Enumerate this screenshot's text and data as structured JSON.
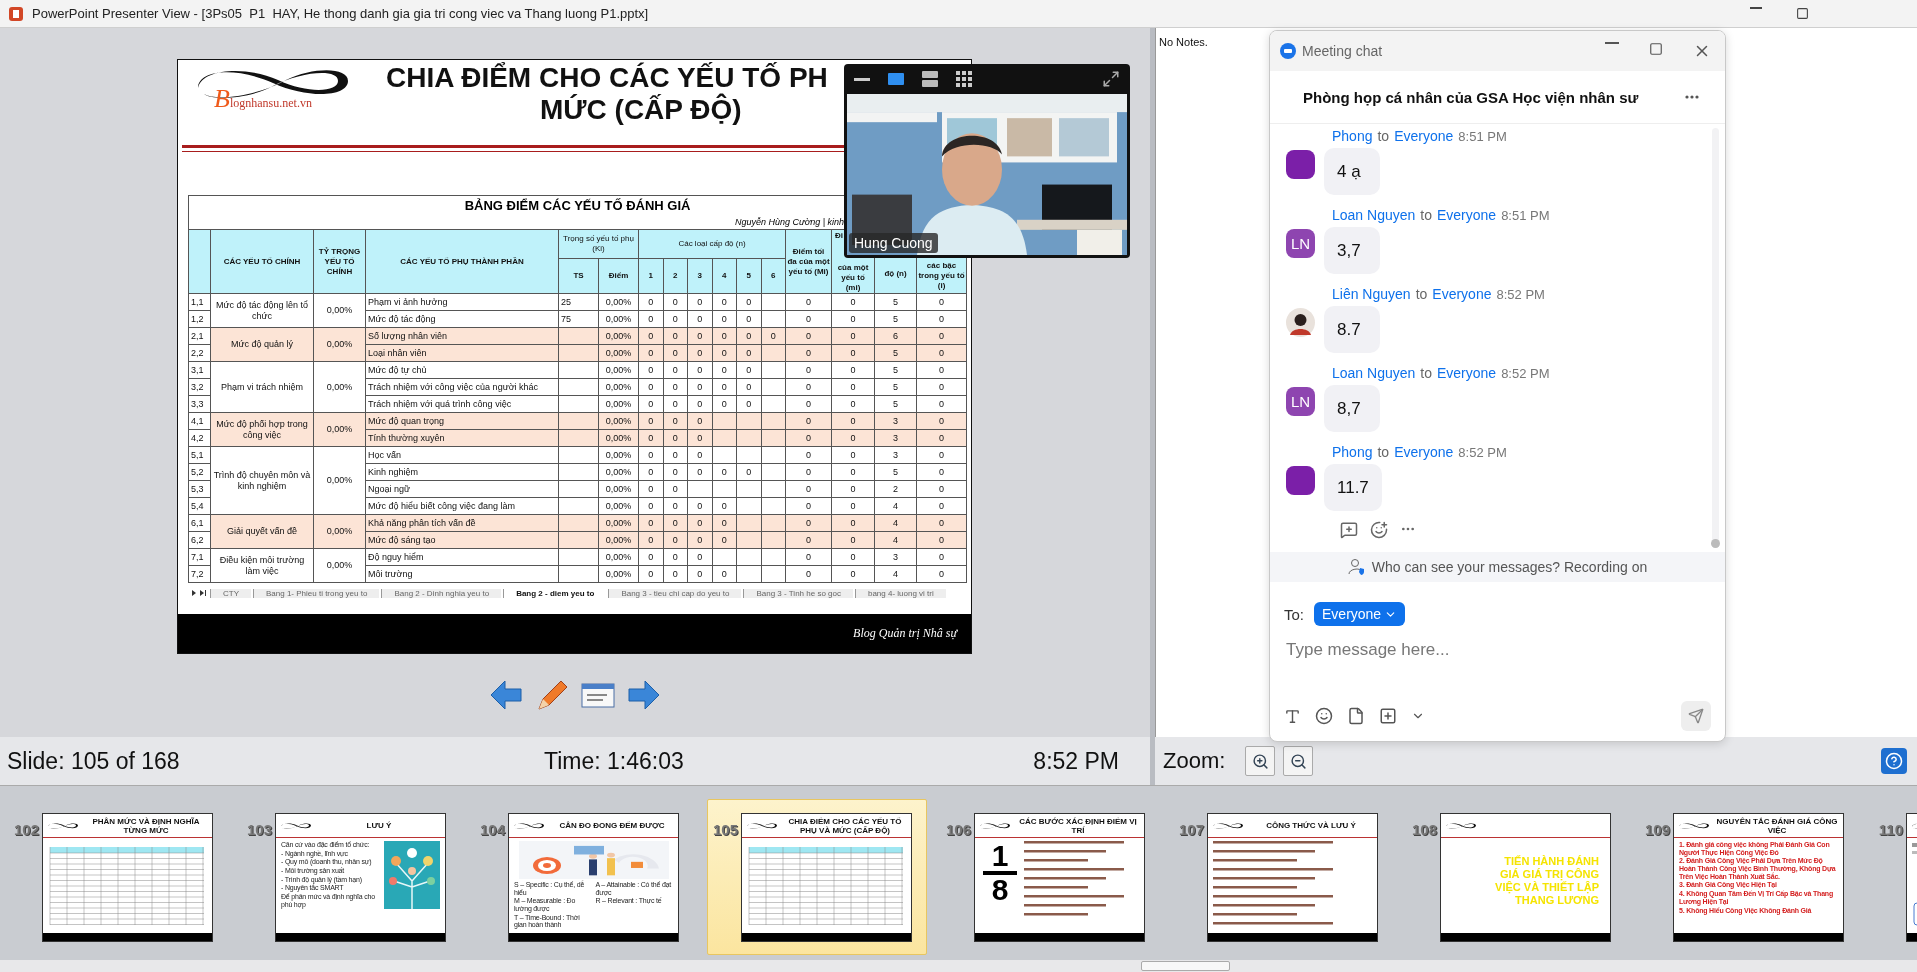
{
  "window": {
    "title": "PowerPoint Presenter View - [3Ps05  P1  HAY, He thong danh gia gia tri cong viec va Thang luong P1.pptx]"
  },
  "slide": {
    "logo": "Blognhansu.net.vn",
    "title_lines": [
      "CHIA ĐIỂM CHO CÁC YẾU TỐ PH",
      "MỨC (CẤP ĐỘ)"
    ],
    "table": {
      "title": "BẢNG ĐIỂM CÁC YẾU TỐ ĐÁNH GIÁ",
      "author": "Nguyễn Hùng Cường | kinh",
      "headers": {
        "main": "CÁC YẾU TỐ CHÍNH",
        "ratio": "TỶ TRỌNG YẾU TỐ CHÍNH",
        "sub": "CÁC YẾU TỐ PHỤ THÀNH PHẦN",
        "weight": "Trọng số yếu tố phụ (Ki)",
        "ts": "TS",
        "score": "Điểm",
        "levels": "Các loại cấp độ (n)",
        "level_numbers": [
          "1",
          "2",
          "3",
          "4",
          "5",
          "6"
        ],
        "max": "Điểm tối đa của một yếu tố (Mi)",
        "min_top": "Đi",
        "min": "của một yếu tố (mi)",
        "count": "độ (n)",
        "step": "các bậc trong yếu tố (i)"
      },
      "groups": [
        {
          "name": "Mức độ tác động lên tổ chức",
          "ratio": "0,00%",
          "shaded": false,
          "rows": [
            {
              "code": "1,1",
              "name": "Phạm vi ảnh hưởng",
              "ts": "25",
              "score": "0,00%",
              "levels": [
                "0",
                "0",
                "0",
                "0",
                "0"
              ],
              "max": "0",
              "min": "0",
              "count": "5",
              "step": "0"
            },
            {
              "code": "1,2",
              "name": "Mức độ tác động",
              "ts": "75",
              "score": "0,00%",
              "levels": [
                "0",
                "0",
                "0",
                "0",
                "0"
              ],
              "max": "0",
              "min": "0",
              "count": "5",
              "step": "0"
            }
          ]
        },
        {
          "name": "Mức độ quản lý",
          "ratio": "0,00%",
          "shaded": true,
          "rows": [
            {
              "code": "2,1",
              "name": "Số lượng nhân viên",
              "score": "0,00%",
              "levels": [
                "0",
                "0",
                "0",
                "0",
                "0",
                "0"
              ],
              "max": "0",
              "min": "0",
              "count": "6",
              "step": "0"
            },
            {
              "code": "2,2",
              "name": "Loại nhân viên",
              "score": "0,00%",
              "levels": [
                "0",
                "0",
                "0",
                "0",
                "0"
              ],
              "max": "0",
              "min": "0",
              "count": "5",
              "step": "0"
            }
          ]
        },
        {
          "name": "Phạm vi trách nhiệm",
          "ratio": "0,00%",
          "shaded": false,
          "rows": [
            {
              "code": "3,1",
              "name": "Mức độ tự chủ",
              "score": "0,00%",
              "levels": [
                "0",
                "0",
                "0",
                "0",
                "0"
              ],
              "max": "0",
              "min": "0",
              "count": "5",
              "step": "0"
            },
            {
              "code": "3,2",
              "name": "Trách nhiệm với công việc của người khác",
              "score": "0,00%",
              "levels": [
                "0",
                "0",
                "0",
                "0",
                "0"
              ],
              "max": "0",
              "min": "0",
              "count": "5",
              "step": "0"
            },
            {
              "code": "3,3",
              "name": "Trách nhiệm với quá trình công việc",
              "score": "0,00%",
              "levels": [
                "0",
                "0",
                "0",
                "0",
                "0"
              ],
              "max": "0",
              "min": "0",
              "count": "5",
              "step": "0"
            }
          ]
        },
        {
          "name": "Mức độ phối hợp trong công việc",
          "ratio": "0,00%",
          "shaded": true,
          "rows": [
            {
              "code": "4,1",
              "name": "Mức độ quan trọng",
              "score": "0,00%",
              "levels": [
                "0",
                "0",
                "0"
              ],
              "max": "0",
              "min": "0",
              "count": "3",
              "step": "0"
            },
            {
              "code": "4,2",
              "name": "Tính thường xuyên",
              "score": "0,00%",
              "levels": [
                "0",
                "0",
                "0"
              ],
              "max": "0",
              "min": "0",
              "count": "3",
              "step": "0"
            }
          ]
        },
        {
          "name": "Trình độ chuyên môn và kinh nghiệm",
          "ratio": "0,00%",
          "shaded": false,
          "rows": [
            {
              "code": "5,1",
              "name": "Học vấn",
              "score": "0,00%",
              "levels": [
                "0",
                "0",
                "0"
              ],
              "max": "0",
              "min": "0",
              "count": "3",
              "step": "0"
            },
            {
              "code": "5,2",
              "name": "Kinh nghiệm",
              "score": "0,00%",
              "levels": [
                "0",
                "0",
                "0",
                "0",
                "0"
              ],
              "max": "0",
              "min": "0",
              "count": "5",
              "step": "0"
            },
            {
              "code": "5,3",
              "name": "Ngoại ngữ",
              "score": "0,00%",
              "levels": [
                "0",
                "0"
              ],
              "max": "0",
              "min": "0",
              "count": "2",
              "step": "0"
            },
            {
              "code": "5,4",
              "name": "Mức độ hiểu biết công việc đang làm",
              "score": "0,00%",
              "levels": [
                "0",
                "0",
                "0",
                "0"
              ],
              "max": "0",
              "min": "0",
              "count": "4",
              "step": "0"
            }
          ]
        },
        {
          "name": "Giải quyết vấn đề",
          "ratio": "0,00%",
          "shaded": true,
          "rows": [
            {
              "code": "6,1",
              "name": "Khả năng phân tích vấn đề",
              "score": "0,00%",
              "levels": [
                "0",
                "0",
                "0",
                "0"
              ],
              "max": "0",
              "min": "0",
              "count": "4",
              "step": "0"
            },
            {
              "code": "6,2",
              "name": "Mức độ sáng tạo",
              "score": "0,00%",
              "levels": [
                "0",
                "0",
                "0",
                "0"
              ],
              "max": "0",
              "min": "0",
              "count": "4",
              "step": "0"
            }
          ]
        },
        {
          "name": "Điều kiện môi trường làm việc",
          "ratio": "0,00%",
          "shaded": false,
          "rows": [
            {
              "code": "7,1",
              "name": "Độ nguy hiểm",
              "score": "0,00%",
              "levels": [
                "0",
                "0",
                "0"
              ],
              "max": "0",
              "min": "0",
              "count": "3",
              "step": "0"
            },
            {
              "code": "7,2",
              "name": "Môi trường",
              "score": "0,00%",
              "levels": [
                "0",
                "0",
                "0",
                "0"
              ],
              "max": "0",
              "min": "0",
              "count": "4",
              "step": "0"
            }
          ]
        }
      ]
    },
    "sheet_tabs": [
      {
        "label": "CTY",
        "selected": false
      },
      {
        "label": "Bang 1- Phieu ti trong yeu to",
        "selected": false
      },
      {
        "label": "Bang 2 - Dinh nghia yeu to",
        "selected": false
      },
      {
        "label": "Bang 2 - diem yeu to",
        "selected": true
      },
      {
        "label": "Bang 3 - tieu chi cap do yeu to",
        "selected": false
      },
      {
        "label": "Bang 3 - Tinh he so goc",
        "selected": false
      },
      {
        "label": "bang 4- luong vi tri",
        "selected": false
      }
    ],
    "footer": "Blog Quản trị Nhâ sự"
  },
  "video": {
    "name": "Hung Cuong"
  },
  "status": {
    "slide": "Slide: 105 of 168",
    "time": "Time: 1:46:03",
    "clock": "8:52 PM"
  },
  "notes": {
    "text": "No Notes.",
    "zoom_label": "Zoom:"
  },
  "chat": {
    "title": "Meeting chat",
    "room": "Phòng họp cá nhân của GSA Học viện nhân sư",
    "messages": [
      {
        "sender": "Phong",
        "to": "to",
        "recipient": "Everyone",
        "time": "8:51 PM",
        "text": "4 ạ",
        "avatar": {
          "kind": "color",
          "color": "#7b1fa8"
        }
      },
      {
        "sender": "Loan Nguyen",
        "to": "to",
        "recipient": "Everyone",
        "time": "8:51 PM",
        "text": "3,7",
        "avatar": {
          "kind": "initials",
          "initials": "LN",
          "color": "#8e45b0"
        }
      },
      {
        "sender": "Liên Nguyen",
        "to": "to",
        "recipient": "Everyone",
        "time": "8:52 PM",
        "text": "8.7"
      },
      {
        "sender": "Loan Nguyen",
        "to": "to",
        "recipient": "Everyone",
        "time": "8:52 PM",
        "text": "8,7",
        "avatar": {
          "kind": "initials",
          "initials": "LN",
          "color": "#8e45b0"
        }
      },
      {
        "sender": "Phong",
        "to": "to",
        "recipient": "Everyone",
        "time": "8:52 PM",
        "text": "11.7",
        "avatar": {
          "kind": "color",
          "color": "#7b1fa8"
        }
      }
    ],
    "privacy": "Who can see your messages? Recording on",
    "to_label": "To:",
    "recipient": "Everyone",
    "placeholder": "Type message here..."
  },
  "thumbnails": [
    {
      "number": "102",
      "title": "PHÂN MỨC VÀ ĐỊNH NGHĨA TỪNG MỨC",
      "selected": false,
      "kind": "table"
    },
    {
      "number": "103",
      "title": "LƯU Ý",
      "selected": false,
      "kind": "bullets",
      "lines": [
        "Căn cứ vào đặc điểm tổ chức:",
        "- Ngành nghề, lĩnh vực",
        "- Quy mô (doanh thu, nhân sự)",
        "- Môi trường sản xuất",
        "- Trình độ quản lý (tầm hạn)",
        "- Nguyên tắc SMART",
        "Để phân mức và định nghĩa cho phù hợp"
      ]
    },
    {
      "number": "104",
      "title": "CÂN ĐO ĐONG ĐẾM ĐƯỢC",
      "selected": false,
      "kind": "smart",
      "lines": [
        "S – Specific : Cụ thể, dễ hiểu",
        "A – Attainable : Có thể đạt được",
        "M – Measurable : Đo lường được",
        "R – Relevant : Thực tế",
        "T – Time-Bound : Thời gian hoàn thành"
      ]
    },
    {
      "number": "105",
      "title": "CHIA ĐIỂM CHO CÁC YẾU TỐ PHỤ VÀ MỨC (CẤP ĐỘ)",
      "selected": true,
      "kind": "table"
    },
    {
      "number": "106",
      "title": "CÁC BƯỚC XÁC ĐỊNH ĐIỂM VỊ TRÍ",
      "selected": false,
      "kind": "fraction",
      "numerator": "1",
      "denominator": "8"
    },
    {
      "number": "107",
      "title": "CÔNG THỨC VÀ LƯU Ý",
      "selected": false,
      "kind": "notes"
    },
    {
      "number": "108",
      "selected": false,
      "kind": "headline",
      "headline": "TIẾN HÀNH ĐÁNH GIÁ GIÁ TRỊ CÔNG VIỆC VÀ THIẾT LẬP THANG LƯƠNG"
    },
    {
      "number": "109",
      "title": "NGUYÊN TẮC ĐÁNH GIÁ CÔNG VIỆC",
      "selected": false,
      "kind": "numbered",
      "items": [
        {
          "n": "1.",
          "text": "Đánh giá công việc không Phải Đánh Giá Con Người Thực Hiện Công Việc Đó"
        },
        {
          "n": "2.",
          "text": "Đánh Giá Công Việc Phải Dựa Trên Mức Độ Hoàn Thành Công Việc Bình Thường, Không Dựa Trên Việc Hoàn Thành Xuất Sắc."
        },
        {
          "n": "3.",
          "text": "Đánh Giá Công Việc Hiện Tại"
        },
        {
          "n": "4.",
          "text": "Không Quan Tâm Đến Vị Trí Cấp Bậc và Thang Lương Hiện Tại"
        },
        {
          "n": "5.",
          "text": "Không Hiểu Công Việc Không Đánh Giá"
        }
      ]
    },
    {
      "number": "110",
      "selected": false,
      "kind": "diagram"
    }
  ]
}
